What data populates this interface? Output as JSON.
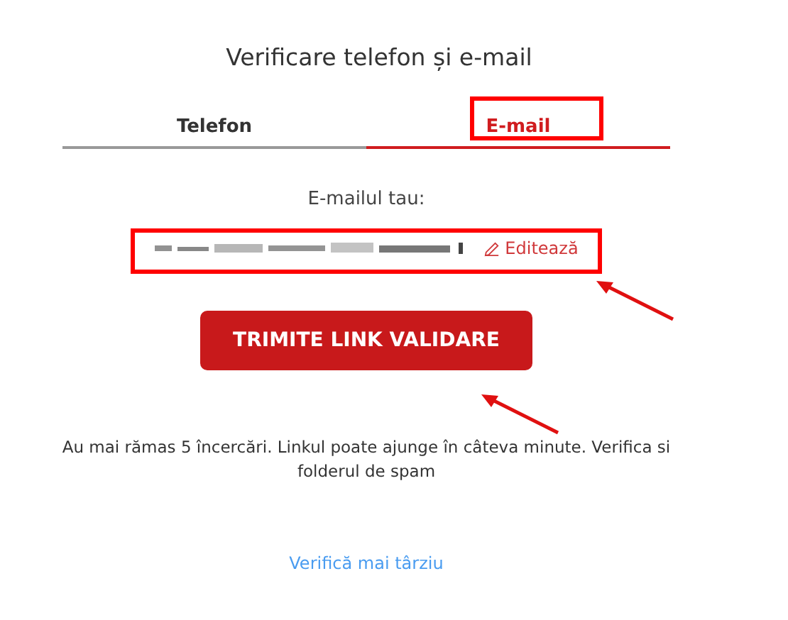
{
  "title": "Verificare telefon și e-mail",
  "tabs": [
    {
      "label": "Telefon",
      "selected": false,
      "highlighted": false
    },
    {
      "label": "E-mail",
      "selected": true,
      "highlighted": true
    }
  ],
  "email": {
    "label": "E-mailul tau:",
    "redacted": true,
    "edit": "Editează",
    "highlighted": true,
    "arrow": true
  },
  "send_button": {
    "label": "TRIMITE LINK VALIDARE",
    "arrow": true
  },
  "info": "Au mai rămas 5 încercări. Linkul poate ajunge în câteva minute. Verifica si folderul de spam",
  "later_link": "Verifică mai târziu"
}
